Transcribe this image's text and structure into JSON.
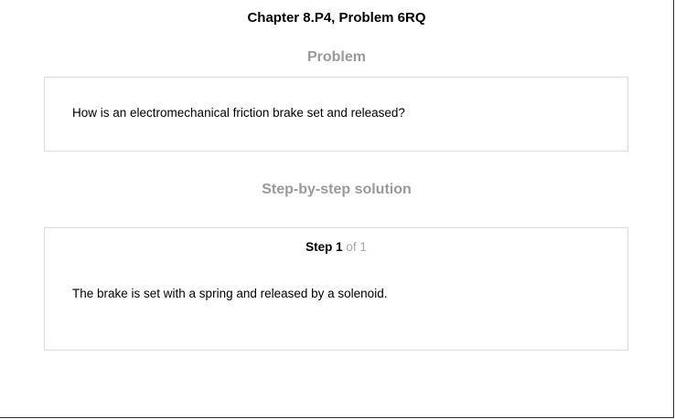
{
  "header": {
    "chapter_title": "Chapter 8.P4, Problem 6RQ"
  },
  "problem": {
    "heading": "Problem",
    "text": "How is an electromechanical friction brake set and released?"
  },
  "solution": {
    "heading": "Step-by-step solution",
    "step": {
      "label": "Step",
      "number": "1",
      "of_total": "of 1"
    },
    "text": "The brake is set with a spring and released by a solenoid."
  },
  "colors": {
    "heading_gray": "#9a9a9a",
    "card_border": "#dcdcdc",
    "muted_gray": "#a8a8a8"
  }
}
